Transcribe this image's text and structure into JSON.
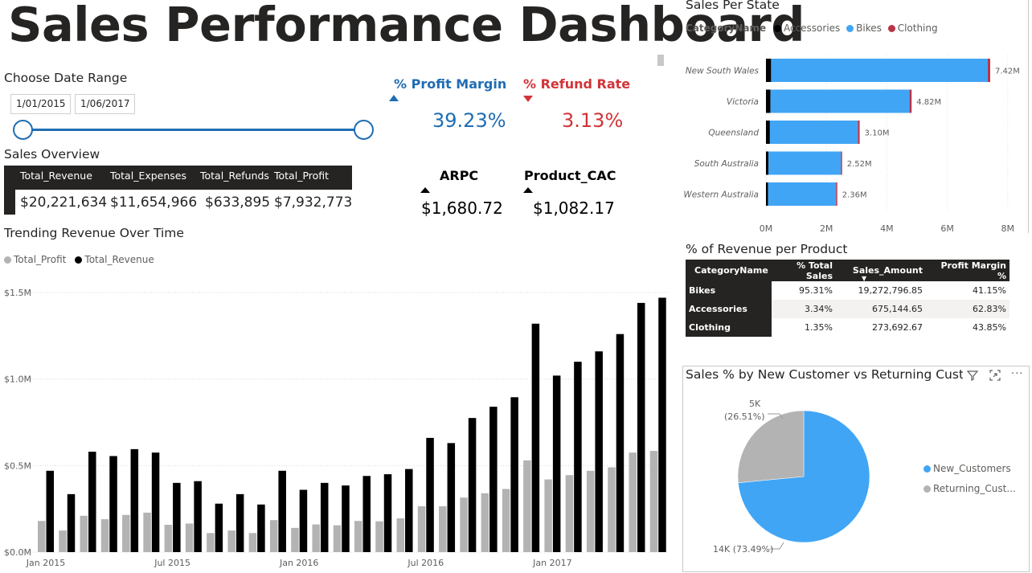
{
  "header": {
    "title": "Sales Performance Dashboard"
  },
  "date_range": {
    "label": "Choose Date Range",
    "start": "1/01/2015",
    "end": "1/06/2017",
    "accent": "#1f6db3"
  },
  "kpis": {
    "profit_margin": {
      "label": "% Profit Margin",
      "value": "39.23%",
      "color": "#1f6db3"
    },
    "refund_rate": {
      "label": "% Refund Rate",
      "value": "3.13%",
      "color": "#d13438"
    },
    "arpc": {
      "label": "ARPC",
      "value": "$1,680.72"
    },
    "product_cac": {
      "label": "Product_CAC",
      "value": "$1,082.17"
    }
  },
  "sales_overview": {
    "title": "Sales Overview",
    "headers": [
      "Total_Revenue",
      "Total_Expenses",
      "Total_Refunds",
      "Total_Profit"
    ],
    "values": [
      "$20,221,634",
      "$11,654,966",
      "$633,895",
      "$7,932,773"
    ]
  },
  "trend": {
    "title": "Trending Revenue Over Time",
    "legend": [
      "Total_Profit",
      "Total_Revenue"
    ],
    "colors": {
      "profit": "#b3b3b3",
      "revenue": "#000000"
    },
    "y_ticks": [
      "$1.5M",
      "$1.0M",
      "$0.5M",
      "$0.0M"
    ],
    "x_ticks": [
      "Jan 2015",
      "Jul 2015",
      "Jan 2016",
      "Jul 2016",
      "Jan 2017"
    ]
  },
  "state": {
    "title": "Sales Per State",
    "legend_title": "CategoryName",
    "legend": [
      "Accessories",
      "Bikes",
      "Clothing"
    ],
    "colors": {
      "Accessories": "#000000",
      "Bikes": "#41a5f5",
      "Clothing": "#b9344a"
    },
    "x_ticks": [
      "0M",
      "2M",
      "4M",
      "6M",
      "8M"
    ]
  },
  "product": {
    "title": "% of Revenue per Product",
    "headers": [
      "CategoryName",
      "% Total Sales",
      "Sales_Amount",
      "Profit Margin %"
    ],
    "rows": [
      [
        "Bikes",
        "95.31%",
        "19,272,796.85",
        "41.15%"
      ],
      [
        "Accessories",
        "3.34%",
        "675,144.65",
        "62.83%"
      ],
      [
        "Clothing",
        "1.35%",
        "273,692.67",
        "43.85%"
      ]
    ]
  },
  "customer": {
    "title": "Sales % by New Customer vs Returning Custo",
    "legend": [
      "New_Customers",
      "Returning_Cust..."
    ],
    "colors": {
      "new": "#41a5f5",
      "returning": "#b3b3b3"
    },
    "label_returning": [
      "5K",
      "(26.51%)"
    ],
    "label_new": "14K (73.49%)",
    "icons": [
      "filter-icon",
      "focus-mode-icon",
      "more-options-icon"
    ]
  },
  "chart_data": [
    {
      "type": "bar",
      "title": "Trending Revenue Over Time",
      "xlabel": "",
      "ylabel": "",
      "ylim": [
        0,
        1500000
      ],
      "categories": [
        "Jan 2015",
        "Feb 2015",
        "Mar 2015",
        "Apr 2015",
        "May 2015",
        "Jun 2015",
        "Jul 2015",
        "Aug 2015",
        "Sep 2015",
        "Oct 2015",
        "Nov 2015",
        "Dec 2015",
        "Jan 2016",
        "Feb 2016",
        "Mar 2016",
        "Apr 2016",
        "May 2016",
        "Jun 2016",
        "Jul 2016",
        "Aug 2016",
        "Sep 2016",
        "Oct 2016",
        "Nov 2016",
        "Dec 2016",
        "Jan 2017",
        "Feb 2017",
        "Mar 2017",
        "Apr 2017",
        "May 2017",
        "Jun 2017"
      ],
      "series": [
        {
          "name": "Total_Profit",
          "values": [
            180000,
            125000,
            210000,
            190000,
            215000,
            228000,
            158000,
            165000,
            110000,
            125000,
            110000,
            185000,
            140000,
            160000,
            155000,
            180000,
            178000,
            195000,
            265000,
            265000,
            315000,
            340000,
            365000,
            530000,
            420000,
            445000,
            470000,
            490000,
            575000,
            585000
          ]
        },
        {
          "name": "Total_Revenue",
          "values": [
            470000,
            335000,
            580000,
            555000,
            595000,
            575000,
            400000,
            410000,
            280000,
            335000,
            275000,
            470000,
            360000,
            400000,
            385000,
            440000,
            450000,
            480000,
            660000,
            630000,
            775000,
            840000,
            895000,
            1320000,
            1020000,
            1100000,
            1160000,
            1260000,
            1440000,
            1470000
          ]
        }
      ],
      "grid": true,
      "legend": "top-left"
    },
    {
      "type": "bar",
      "orientation": "horizontal",
      "stacked": true,
      "title": "Sales Per State",
      "categories": [
        "New South Wales",
        "Victoria",
        "Queensland",
        "South Australia",
        "Western Australia"
      ],
      "series": [
        {
          "name": "Accessories",
          "values": [
            0.17,
            0.15,
            0.13,
            0.08,
            0.07
          ]
        },
        {
          "name": "Bikes",
          "values": [
            7.17,
            4.6,
            2.91,
            2.4,
            2.25
          ]
        },
        {
          "name": "Clothing",
          "values": [
            0.08,
            0.07,
            0.06,
            0.04,
            0.04
          ]
        }
      ],
      "totals": [
        "7.42M",
        "4.82M",
        "3.10M",
        "2.52M",
        "2.36M"
      ],
      "xlim": [
        0,
        8
      ],
      "legend": "top-left"
    },
    {
      "type": "pie",
      "title": "Sales % by New Customer vs Returning Custo",
      "labels": [
        "New_Customers",
        "Returning_Cust..."
      ],
      "values": [
        73.49,
        26.51
      ],
      "legend": "right"
    }
  ]
}
